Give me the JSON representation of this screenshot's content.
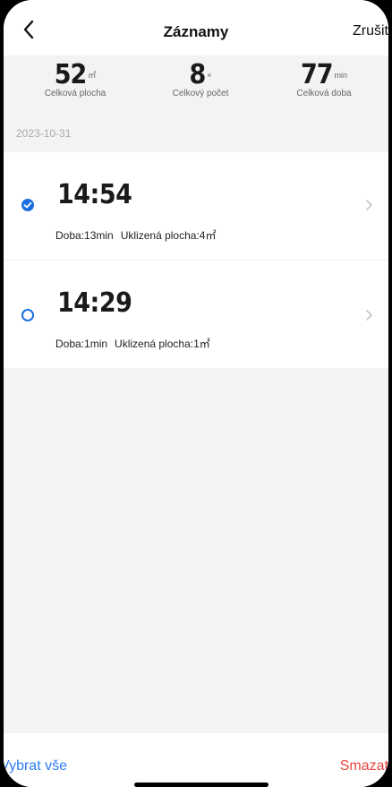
{
  "header": {
    "title": "Záznamy",
    "cancel_label": "Zrušit"
  },
  "stats": [
    {
      "value": "52",
      "unit": "㎡",
      "label": "Celková plocha"
    },
    {
      "value": "8",
      "unit": "×",
      "label": "Celkový počet"
    },
    {
      "value": "77",
      "unit": "min",
      "label": "Celková doba"
    }
  ],
  "date": "2023-10-31",
  "records": [
    {
      "time": "14:54",
      "duration": "Doba:13min",
      "area": "Uklizená plocha:4㎡",
      "selected": true
    },
    {
      "time": "14:29",
      "duration": "Doba:1min",
      "area": "Uklizená plocha:1㎡",
      "selected": false
    }
  ],
  "footer": {
    "select_all_label": "Vybrat vše",
    "delete_label": "Smazat"
  },
  "colors": {
    "accent": "#1a6fe0",
    "delete": "#e8463f",
    "link": "#2e7cf6"
  }
}
